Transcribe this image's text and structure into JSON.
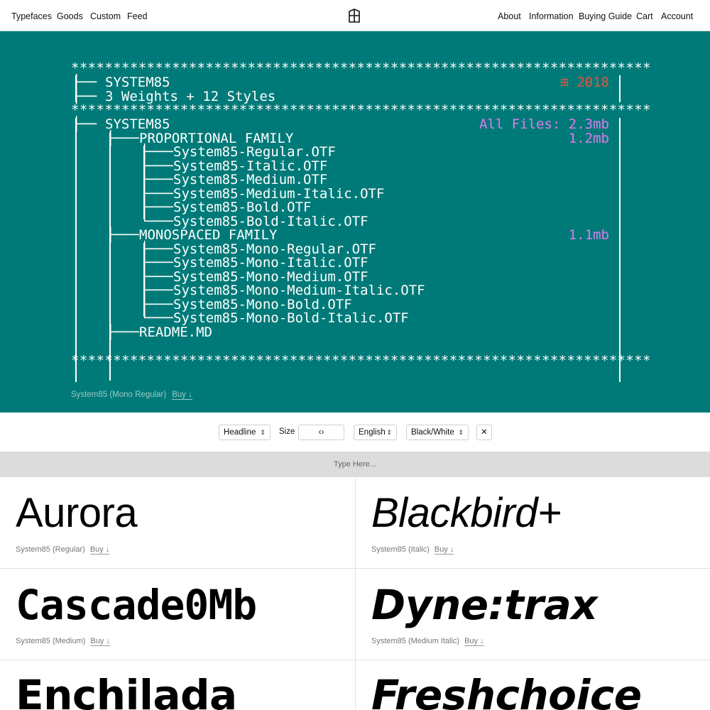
{
  "nav": {
    "left": [
      "Typefaces",
      "Goods",
      "Custom",
      "Feed"
    ],
    "right": [
      "About",
      "Information",
      "Buying Guide",
      "Cart",
      "Account"
    ]
  },
  "tree": {
    "stars": "*********************************************************************",
    "header_title": "SYSTEM85",
    "header_subtitle": "3 Weights + 12 Styles",
    "year": "⊞ 2018",
    "root": "SYSTEM85",
    "all_files": "All Files: 2.3mb",
    "proportional": {
      "label": "PROPORTIONAL FAMILY",
      "size": "1.2mb",
      "files": [
        "System85-Regular.OTF",
        "System85-Italic.OTF",
        "System85-Medium.OTF",
        "System85-Medium-Italic.OTF",
        "System85-Bold.OTF",
        "System85-Bold-Italic.OTF"
      ]
    },
    "monospaced": {
      "label": "MONOSPACED FAMILY",
      "size": "1.1mb",
      "files": [
        "System85-Mono-Regular.OTF",
        "System85-Mono-Italic.OTF",
        "System85-Mono-Medium.OTF",
        "System85-Mono-Medium-Italic.OTF",
        "System85-Mono-Bold.OTF",
        "System85-Mono-Bold-Italic.OTF"
      ]
    },
    "readme": "README.MD"
  },
  "hero_caption": {
    "font": "System85 (Mono Regular)",
    "buy": "Buy ↓"
  },
  "controls": {
    "style_select": "Headline",
    "size_label": "Size",
    "size_value": "‹›",
    "language_select": "English",
    "color_select": "Black/White",
    "close": "✕"
  },
  "typehere": {
    "placeholder": "Type Here..."
  },
  "specimens": [
    {
      "sample": "Aurora",
      "font": "System85 (Regular)",
      "buy": "Buy ↓"
    },
    {
      "sample": "Blackbird+",
      "font": "System85 (Italic)",
      "buy": "Buy ↓"
    },
    {
      "sample": "Cascade0Mb",
      "font": "System85 (Medium)",
      "buy": "Buy ↓"
    },
    {
      "sample": "Dyne:trax",
      "font": "System85 (Medium Italic)",
      "buy": "Buy ↓"
    },
    {
      "sample": "Enchilada",
      "font": "",
      "buy": ""
    },
    {
      "sample": "Freshchoice",
      "font": "",
      "buy": ""
    }
  ],
  "colors": {
    "hero_bg": "#007a78",
    "accent_red": "#e2563f",
    "accent_purple": "#d97cf0",
    "input_bar": "#dcdcdc"
  }
}
